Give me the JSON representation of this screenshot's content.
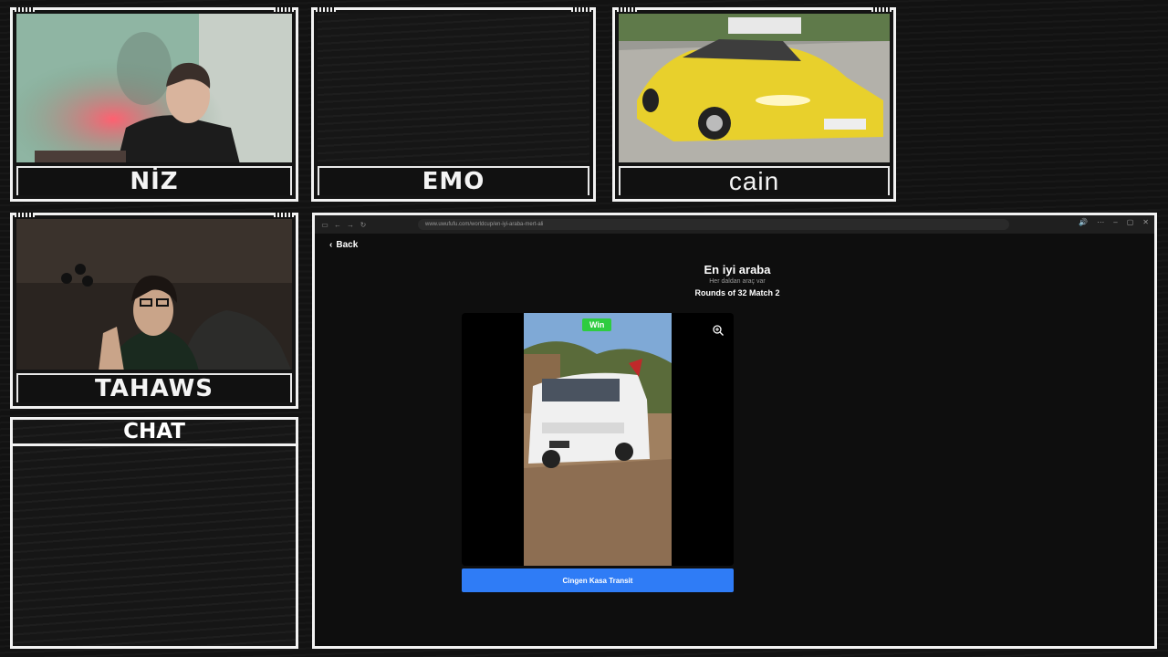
{
  "cams": {
    "niz": {
      "name": "NİZ"
    },
    "emo": {
      "name": "EMO"
    },
    "cain": {
      "name": "cain"
    },
    "tahaws": {
      "name": "TAHAWS"
    }
  },
  "chat": {
    "title": "CHAT"
  },
  "browser": {
    "url": "www.uwufufu.com/worldcup/en-iyi-araba-mert-ali",
    "nav_icons": [
      "sidebar-icon",
      "back-arrow-icon",
      "forward-arrow-icon",
      "reload-icon"
    ],
    "window_controls": [
      "sound-icon",
      "more-icon",
      "minimize-icon",
      "maximize-icon",
      "close-icon"
    ]
  },
  "page": {
    "back_label": "Back",
    "title": "En iyi araba",
    "subtitle": "Her daldan araç var",
    "rounds": "Rounds of 32 Match 2",
    "win_badge": "Win",
    "choice_label": "Cingen Kasa Transit"
  },
  "colors": {
    "frame": "#f2f2f2",
    "accent_blue": "#2f7cf6",
    "win_green": "#2ecc40",
    "car_yellow": "#e8d02c"
  }
}
